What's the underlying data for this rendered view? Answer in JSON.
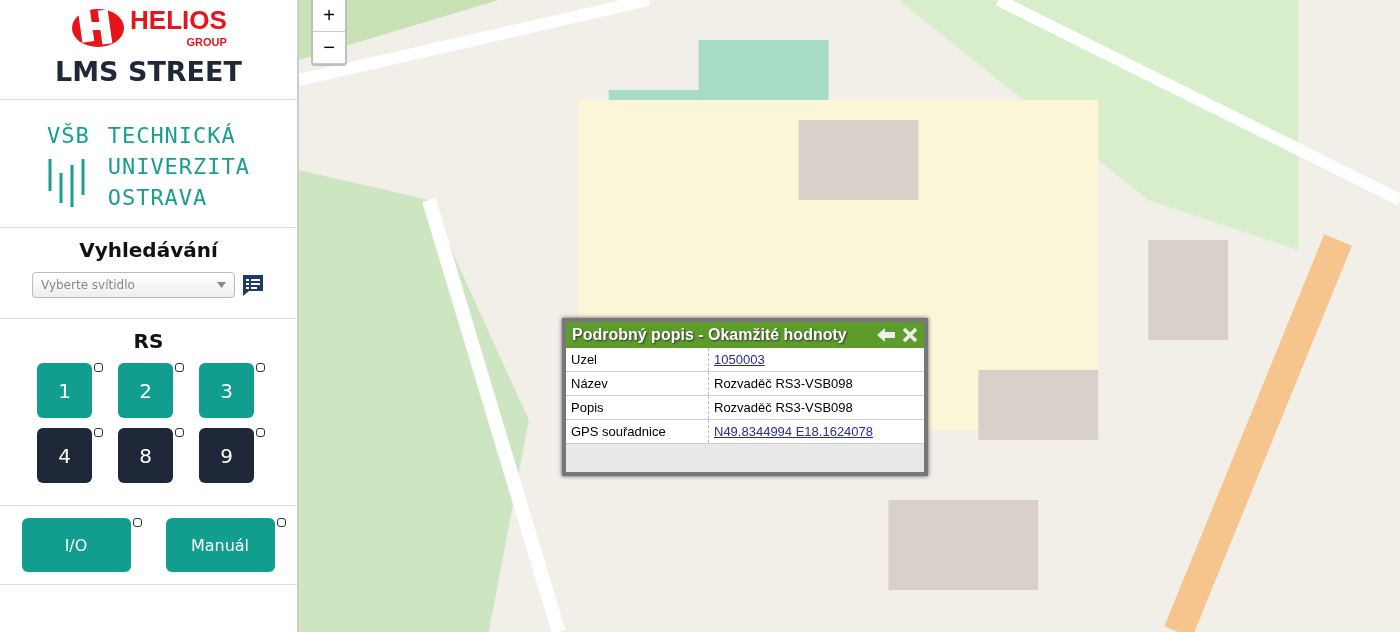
{
  "sidebar": {
    "helios_logo": {
      "name": "HELIOS",
      "sub": "GROUP"
    },
    "app_title": "LMS STREET",
    "university_logo": {
      "abbr": "VŠB",
      "lines": [
        "TECHNICKÁ",
        "UNIVERZITA",
        "OSTRAVA"
      ]
    },
    "search": {
      "heading": "Vyhledávání",
      "placeholder": "Vyberte svítidlo"
    },
    "rs": {
      "heading": "RS",
      "buttons": [
        {
          "label": "1",
          "active": true,
          "checked": false
        },
        {
          "label": "2",
          "active": true,
          "checked": false
        },
        {
          "label": "3",
          "active": true,
          "checked": false
        },
        {
          "label": "4",
          "active": false,
          "checked": false
        },
        {
          "label": "8",
          "active": false,
          "checked": false
        },
        {
          "label": "9",
          "active": false,
          "checked": false
        }
      ]
    },
    "modes": [
      {
        "label": "I/O",
        "checked": false
      },
      {
        "label": "Manuál",
        "checked": false
      }
    ]
  },
  "map": {
    "zoom": [
      "+",
      "−"
    ],
    "popup": {
      "title": "Podrobný popis - Okamžité hodnoty",
      "rows": [
        {
          "label": "Uzel",
          "value": "1050003",
          "link": true
        },
        {
          "label": "Název",
          "value": "Rozvaděč RS3-VSB098",
          "link": false
        },
        {
          "label": "Popis",
          "value": "Rozvaděč RS3-VSB098",
          "link": false
        },
        {
          "label": "GPS souřadnice",
          "value": "N49.8344994 E18.1624078",
          "link": true
        }
      ]
    }
  }
}
